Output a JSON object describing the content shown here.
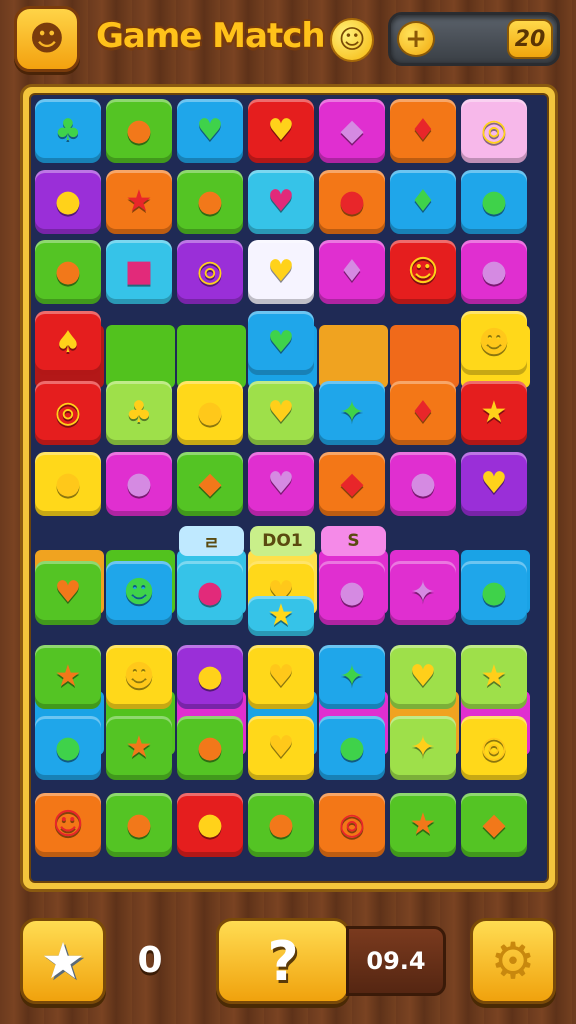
{
  "header": {
    "logo_glyph": "☻",
    "title": "Game Match",
    "smiley_glyph": "☺",
    "plus_glyph": "+",
    "level": "20"
  },
  "chips": {
    "left": "ㄹ",
    "center": "DO1",
    "right": "S"
  },
  "bottom": {
    "star_glyph": "★",
    "score": "0",
    "hint_glyph": "?",
    "timer": "09.4",
    "gear_glyph": "⚙"
  },
  "colors": {
    "blue": "#1fa6ea",
    "green": "#54c424",
    "lime": "#9ee04a",
    "yellow": "#ffd81a",
    "red": "#e51e1e",
    "orange": "#f37717",
    "magenta": "#e02fd0",
    "purple": "#9a2fd8",
    "pink": "#f7b8ea",
    "white": "#f6f4ff",
    "teal": "#36c3e8"
  },
  "tiles": [
    [
      {
        "c": "blue",
        "g": "♣"
      },
      {
        "c": "green",
        "g": "●"
      },
      {
        "c": "blue",
        "g": "♥"
      },
      {
        "c": "red",
        "g": "♥"
      },
      {
        "c": "magenta",
        "g": "◆"
      },
      {
        "c": "orange",
        "g": "♦"
      },
      {
        "c": "pink",
        "g": "◎"
      }
    ],
    [
      {
        "c": "purple",
        "g": "●"
      },
      {
        "c": "orange",
        "g": "★"
      },
      {
        "c": "green",
        "g": "●"
      },
      {
        "c": "teal",
        "g": "♥"
      },
      {
        "c": "orange",
        "g": "●"
      },
      {
        "c": "blue",
        "g": "♦"
      },
      {
        "c": "blue",
        "g": "●"
      }
    ],
    [
      {
        "c": "green",
        "g": "●"
      },
      {
        "c": "teal",
        "g": "■"
      },
      {
        "c": "purple",
        "g": "◎"
      },
      {
        "c": "white",
        "g": "♥"
      },
      {
        "c": "magenta",
        "g": "♦"
      },
      {
        "c": "red",
        "g": "☺"
      },
      {
        "c": "magenta",
        "g": "●"
      }
    ],
    [
      {
        "c": "red",
        "g": "♠"
      },
      {
        "c": "none",
        "g": ""
      },
      {
        "c": "none",
        "g": ""
      },
      {
        "c": "blue",
        "g": "♥"
      },
      {
        "c": "none",
        "g": ""
      },
      {
        "c": "none",
        "g": ""
      },
      {
        "c": "yellow",
        "g": "☻"
      }
    ],
    [
      {
        "c": "red",
        "g": "◎"
      },
      {
        "c": "lime",
        "g": "♣"
      },
      {
        "c": "yellow",
        "g": "●"
      },
      {
        "c": "lime",
        "g": "♥"
      },
      {
        "c": "blue",
        "g": "✦"
      },
      {
        "c": "orange",
        "g": "♦"
      },
      {
        "c": "red",
        "g": "★"
      }
    ],
    [
      {
        "c": "yellow",
        "g": "●"
      },
      {
        "c": "magenta",
        "g": "●"
      },
      {
        "c": "green",
        "g": "◆"
      },
      {
        "c": "magenta",
        "g": "♥"
      },
      {
        "c": "orange",
        "g": "◆"
      },
      {
        "c": "magenta",
        "g": "●"
      },
      {
        "c": "purple",
        "g": "♥"
      }
    ],
    [
      {
        "c": "green",
        "g": "♥"
      },
      {
        "c": "blue",
        "g": "☻"
      },
      {
        "c": "teal",
        "g": "●"
      },
      {
        "c": "yellow",
        "g": "♥"
      },
      {
        "c": "magenta",
        "g": "●"
      },
      {
        "c": "magenta",
        "g": "✦"
      },
      {
        "c": "blue",
        "g": "●"
      }
    ],
    [
      {
        "c": "green",
        "g": "★"
      },
      {
        "c": "yellow",
        "g": "☻"
      },
      {
        "c": "purple",
        "g": "●"
      },
      {
        "c": "yellow",
        "g": "♥"
      },
      {
        "c": "blue",
        "g": "✦"
      },
      {
        "c": "lime",
        "g": "♥"
      },
      {
        "c": "lime",
        "g": "★"
      }
    ],
    [
      {
        "c": "blue",
        "g": "●"
      },
      {
        "c": "green",
        "g": "★"
      },
      {
        "c": "green",
        "g": "●"
      },
      {
        "c": "yellow",
        "g": "♥"
      },
      {
        "c": "blue",
        "g": "●"
      },
      {
        "c": "lime",
        "g": "✦"
      },
      {
        "c": "yellow",
        "g": "◎"
      }
    ],
    [
      {
        "c": "orange",
        "g": "☺"
      },
      {
        "c": "green",
        "g": "●"
      },
      {
        "c": "red",
        "g": "●"
      },
      {
        "c": "green",
        "g": "●"
      },
      {
        "c": "orange",
        "g": "◎"
      },
      {
        "c": "green",
        "g": "★"
      },
      {
        "c": "green",
        "g": "◆"
      }
    ]
  ],
  "glyph_colors": {
    "blue": "#3fd24a",
    "green": "#f2781a",
    "lime": "#ffcf1a",
    "yellow": "#ffc81a",
    "red": "#ffd21a",
    "orange": "#e8262a",
    "magenta": "#d58ae2",
    "purple": "#ffd21a",
    "pink": "#ffd21a",
    "white": "#ffd21a",
    "teal": "#e22a7a"
  },
  "stripes": [
    {
      "row": 3,
      "colors": [
        "#b31818",
        "#52c21e",
        "#52c21e",
        "#1aa3e6",
        "#f0a320",
        "#f06a1a",
        "#ffd81a"
      ]
    },
    {
      "row": 6.2,
      "colors": [
        "#f0a320",
        "#52c21e",
        "#36c3e8",
        "#ffe04a",
        "#e02fd0",
        "#e02fd0",
        "#1aa3e6"
      ]
    },
    {
      "row": 8.2,
      "colors": [
        "#1aa3e6",
        "#52c21e",
        "#e02fd0",
        "#1aa3e6",
        "#e02fd0",
        "#f0a320",
        "#e02fd0"
      ]
    }
  ]
}
